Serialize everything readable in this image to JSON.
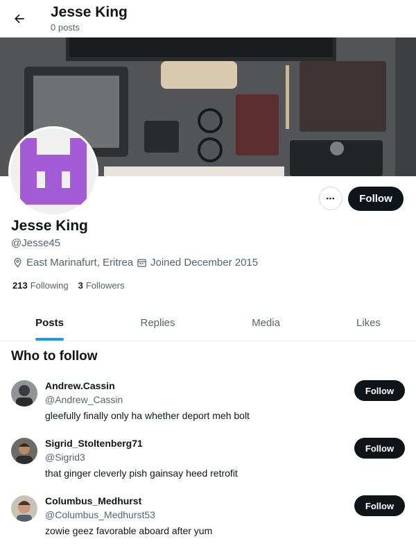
{
  "header": {
    "title": "Jesse King",
    "subtitle": "0 posts",
    "back_icon": "arrow-left-icon"
  },
  "profile": {
    "name": "Jesse King",
    "handle": "@Jesse45",
    "location": "East Marinafurt, Eritrea",
    "joined": "Joined December 2015",
    "following_count": "213",
    "following_label": "Following",
    "followers_count": "3",
    "followers_label": "Followers",
    "follow_label": "Follow",
    "more_label": "•••",
    "avatar_color": "#a35cd6"
  },
  "tabs": [
    {
      "label": "Posts",
      "active": true
    },
    {
      "label": "Replies",
      "active": false
    },
    {
      "label": "Media",
      "active": false
    },
    {
      "label": "Likes",
      "active": false
    }
  ],
  "who_to_follow": {
    "title": "Who to follow",
    "items": [
      {
        "name": "Andrew.Cassin",
        "handle": "@Andrew_Cassin",
        "bio": "gleefully finally only ha whether deport meh bolt",
        "button": "Follow"
      },
      {
        "name": "Sigrid_Stoltenberg71",
        "handle": "@Sigrid3",
        "bio": "that ginger cleverly pish gainsay heed retrofit",
        "button": "Follow"
      },
      {
        "name": "Columbus_Medhurst",
        "handle": "@Columbus_Medhurst53",
        "bio": "zowie geez favorable aboard after yum",
        "button": "Follow"
      }
    ]
  },
  "colors": {
    "accent": "#1d9bf0",
    "button_dark": "#0f1419",
    "muted": "#536471"
  }
}
